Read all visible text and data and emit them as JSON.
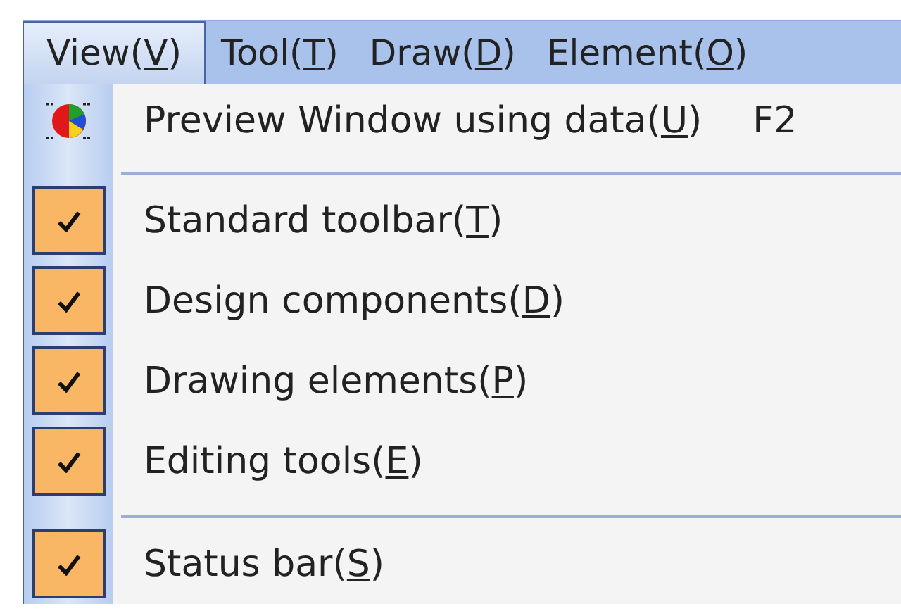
{
  "menu_bar": [
    {
      "before": "View(",
      "key": "V",
      "after": ")",
      "selected": true
    },
    {
      "before": "Tool(",
      "key": "T",
      "after": ")",
      "selected": false
    },
    {
      "before": "Draw(",
      "key": "D",
      "after": ")",
      "selected": false
    },
    {
      "before": "Element(",
      "key": "O",
      "after": ")",
      "selected": false
    }
  ],
  "menu": [
    {
      "kind": "command",
      "before": "Preview Window using data(",
      "key": "U",
      "after": ")",
      "shortcut": "F2"
    },
    {
      "kind": "separator"
    },
    {
      "kind": "check",
      "before": "Standard toolbar(",
      "key": "T",
      "after": ")",
      "checked": true
    },
    {
      "kind": "check",
      "before": "Design components(",
      "key": "D",
      "after": ")",
      "checked": true
    },
    {
      "kind": "check",
      "before": "Drawing elements(",
      "key": "P",
      "after": ")",
      "checked": true
    },
    {
      "kind": "check",
      "before": "Editing tools(",
      "key": "E",
      "after": ")",
      "checked": true
    },
    {
      "kind": "separator"
    },
    {
      "kind": "check",
      "before": "Status bar(",
      "key": "S",
      "after": ")",
      "checked": true
    }
  ]
}
